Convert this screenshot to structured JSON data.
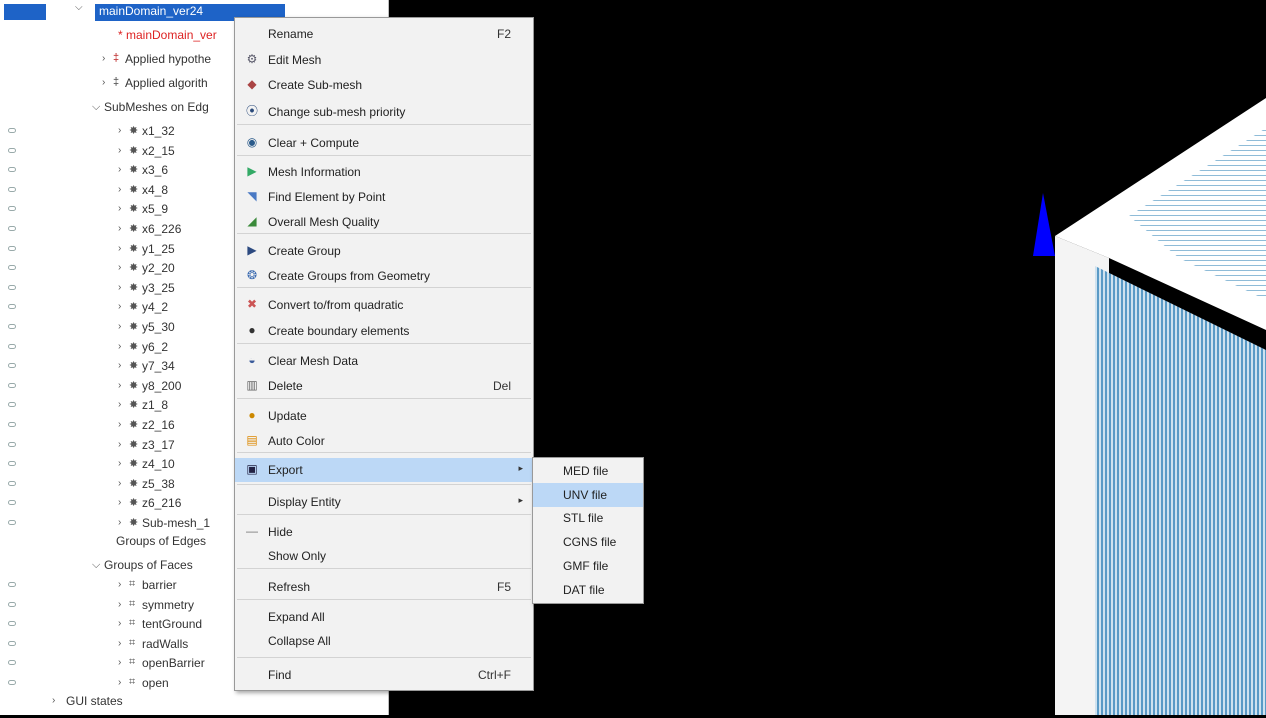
{
  "tree": {
    "root_label": "mainDomain_ver24",
    "mesh_label": "* mainDomain_ver",
    "applied_hyp": "Applied hypothe",
    "applied_alg": "Applied algorith",
    "submeshes_edges": "SubMeshes on Edg",
    "edge_submeshes": [
      "x1_32",
      "x2_15",
      "x3_6",
      "x4_8",
      "x5_9",
      "x6_226",
      "y1_25",
      "y2_20",
      "y3_25",
      "y4_2",
      "y5_30",
      "y6_2",
      "y7_34",
      "y8_200",
      "z1_8",
      "z2_16",
      "z3_17",
      "z4_10",
      "z5_38",
      "z6_216",
      "Sub-mesh_1"
    ],
    "groups_edges": "Groups of Edges",
    "groups_faces": "Groups of Faces",
    "face_groups": [
      "barrier",
      "symmetry",
      "tentGround",
      "radWalls",
      "openBarrier",
      "open"
    ],
    "gui_states": "GUI states"
  },
  "context_menu": {
    "items": [
      {
        "label": "Rename",
        "shortcut": "F2",
        "icon": "none"
      },
      {
        "label": "Edit Mesh",
        "shortcut": "",
        "icon": "edit-mesh-icon"
      },
      {
        "label": "Create Sub-mesh",
        "shortcut": "",
        "icon": "create-submesh-icon"
      },
      {
        "label": "Change sub-mesh priority",
        "shortcut": "",
        "icon": "priority-icon"
      },
      {
        "label": "Clear + Compute",
        "shortcut": "",
        "icon": "compute-icon"
      },
      {
        "label": "Mesh Information",
        "shortcut": "",
        "icon": "info-icon"
      },
      {
        "label": "Find Element by Point",
        "shortcut": "",
        "icon": "find-point-icon"
      },
      {
        "label": "Overall Mesh Quality",
        "shortcut": "",
        "icon": "quality-icon"
      },
      {
        "label": "Create Group",
        "shortcut": "",
        "icon": "group-icon"
      },
      {
        "label": "Create Groups from Geometry",
        "shortcut": "",
        "icon": "groups-geom-icon"
      },
      {
        "label": "Convert to/from quadratic",
        "shortcut": "",
        "icon": "quadratic-icon"
      },
      {
        "label": "Create boundary elements",
        "shortcut": "",
        "icon": "boundary-icon"
      },
      {
        "label": "Clear Mesh Data",
        "shortcut": "",
        "icon": "clear-icon"
      },
      {
        "label": "Delete",
        "shortcut": "Del",
        "icon": "delete-icon"
      },
      {
        "label": "Update",
        "shortcut": "",
        "icon": "update-icon"
      },
      {
        "label": "Auto Color",
        "shortcut": "",
        "icon": "auto-color-icon"
      },
      {
        "label": "Export",
        "shortcut": "",
        "icon": "export-icon"
      },
      {
        "label": "Display Entity",
        "shortcut": "",
        "icon": "none"
      },
      {
        "label": "Hide",
        "shortcut": "",
        "icon": "hide-icon"
      },
      {
        "label": "Show Only",
        "shortcut": "",
        "icon": "none"
      },
      {
        "label": "Refresh",
        "shortcut": "F5",
        "icon": "none"
      },
      {
        "label": "Expand All",
        "shortcut": "",
        "icon": "none"
      },
      {
        "label": "Collapse All",
        "shortcut": "",
        "icon": "none"
      },
      {
        "label": "Find",
        "shortcut": "Ctrl+F",
        "icon": "none"
      }
    ]
  },
  "export_submenu": {
    "items": [
      "MED file",
      "UNV file",
      "STL file",
      "CGNS file",
      "GMF file",
      "DAT file"
    ]
  },
  "colors": {
    "selection": "#1e63c7",
    "menu_highlight": "#bcd8f6",
    "mesh_blue": "#5a9ac6",
    "axis_blue": "#0000ff"
  }
}
